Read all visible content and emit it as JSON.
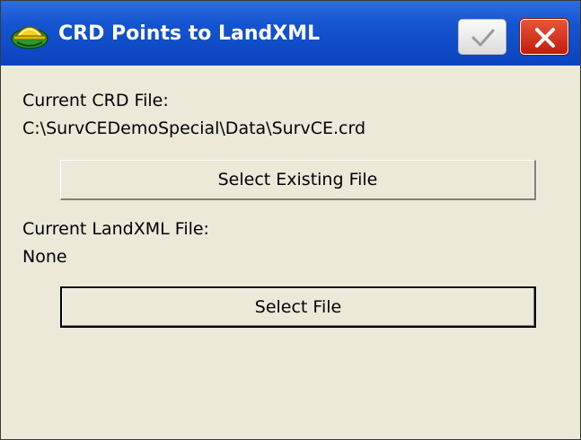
{
  "window": {
    "title": "CRD Points to LandXML",
    "app_icon": "surveyor-helmet-icon",
    "ok_icon": "checkmark-icon",
    "close_icon": "close-x-icon"
  },
  "crd": {
    "label": "Current CRD File:",
    "path": "C:\\SurvCEDemoSpecial\\Data\\SurvCE.crd",
    "button_label": "Select Existing File"
  },
  "landxml": {
    "label": "Current LandXML File:",
    "value": "None",
    "button_label": "Select File"
  },
  "colors": {
    "titlebar": "#1554d0",
    "window_background": "#ece9d8",
    "close_button": "#c21d0c"
  }
}
